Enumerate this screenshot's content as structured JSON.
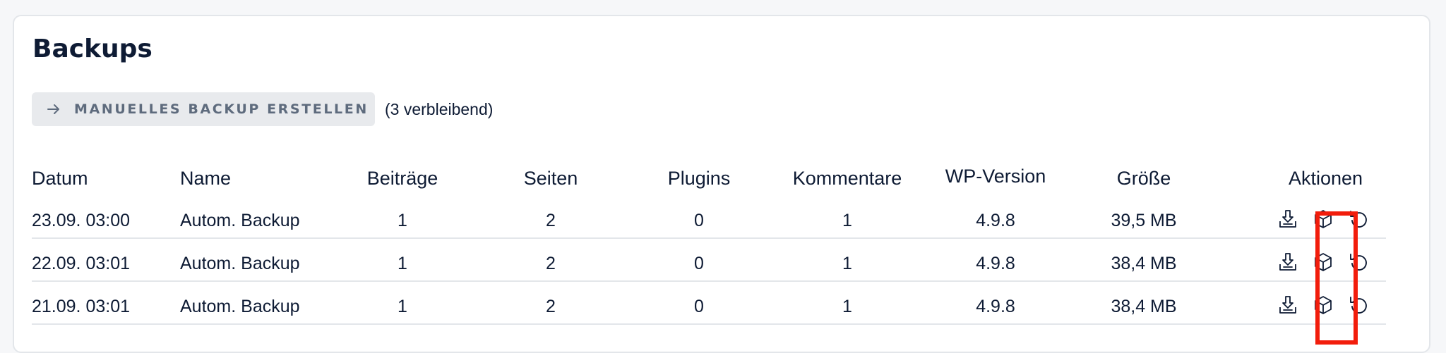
{
  "page": {
    "title": "Backups",
    "create_button_label": "MANUELLES BACKUP ERSTELLEN",
    "remaining_text": "(3 verbleibend)",
    "highlight_color": "#f21d0c"
  },
  "table": {
    "columns": [
      "Datum",
      "Name",
      "Beiträge",
      "Seiten",
      "Plugins",
      "Kommentare",
      "WP-Version",
      "Größe",
      "Aktionen"
    ],
    "rows": [
      {
        "datum": "23.09. 03:00",
        "name": "Autom. Backup",
        "beitraege": "1",
        "seiten": "2",
        "plugins": "0",
        "kommentare": "1",
        "wp_version": "4.9.8",
        "groesse": "39,5 MB",
        "actions": [
          "download-icon",
          "package-icon",
          "restore-icon"
        ]
      },
      {
        "datum": "22.09. 03:01",
        "name": "Autom. Backup",
        "beitraege": "1",
        "seiten": "2",
        "plugins": "0",
        "kommentare": "1",
        "wp_version": "4.9.8",
        "groesse": "38,4 MB",
        "actions": [
          "download-icon",
          "package-icon",
          "restore-icon"
        ]
      },
      {
        "datum": "21.09. 03:01",
        "name": "Autom. Backup",
        "beitraege": "1",
        "seiten": "2",
        "plugins": "0",
        "kommentare": "1",
        "wp_version": "4.9.8",
        "groesse": "38,4 MB",
        "actions": [
          "download-icon",
          "package-icon",
          "restore-icon"
        ]
      }
    ]
  }
}
